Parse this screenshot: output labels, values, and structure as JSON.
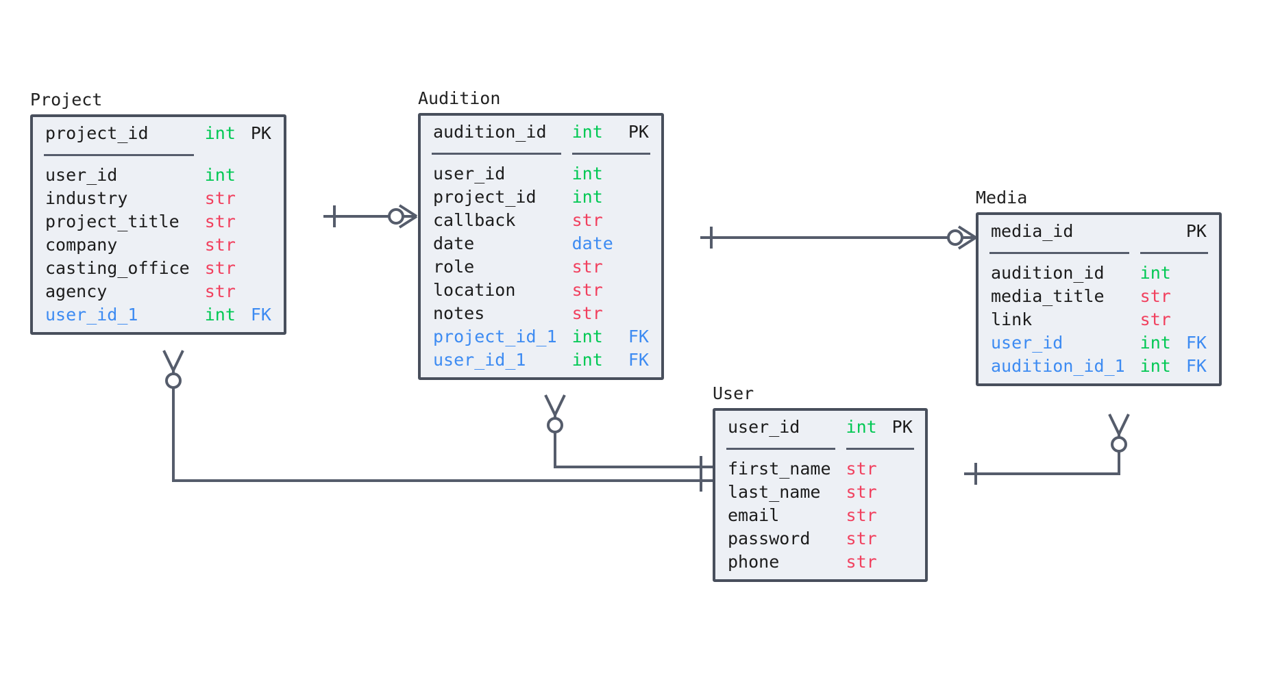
{
  "diagram": {
    "type": "entity-relationship-diagram",
    "background_color": "#ffffff",
    "colors": {
      "entity_fill": "#edf0f5",
      "entity_border": "#484f5c",
      "text": "#1c1c1c",
      "type_int": "#00c853",
      "type_str": "#f1405e",
      "type_date": "#3d8bf2",
      "foreign_key": "#3d8bf2",
      "connector": "#555c6b"
    }
  },
  "entities": [
    {
      "name": "Project",
      "primary_key": {
        "field": "project_id",
        "type": "int",
        "key": "PK"
      },
      "fields": [
        {
          "field": "user_id",
          "type": "int",
          "key": ""
        },
        {
          "field": "industry",
          "type": "str",
          "key": ""
        },
        {
          "field": "project_title",
          "type": "str",
          "key": ""
        },
        {
          "field": "company",
          "type": "str",
          "key": ""
        },
        {
          "field": "casting_office",
          "type": "str",
          "key": ""
        },
        {
          "field": "agency",
          "type": "str",
          "key": ""
        },
        {
          "field": "user_id_1",
          "type": "int",
          "key": "FK"
        }
      ]
    },
    {
      "name": "Audition",
      "primary_key": {
        "field": "audition_id",
        "type": "int",
        "key": "PK"
      },
      "fields": [
        {
          "field": "user_id",
          "type": "int",
          "key": ""
        },
        {
          "field": "project_id",
          "type": "int",
          "key": ""
        },
        {
          "field": "callback",
          "type": "str",
          "key": ""
        },
        {
          "field": "date",
          "type": "date",
          "key": ""
        },
        {
          "field": "role",
          "type": "str",
          "key": ""
        },
        {
          "field": "location",
          "type": "str",
          "key": ""
        },
        {
          "field": "notes",
          "type": "str",
          "key": ""
        },
        {
          "field": "project_id_1",
          "type": "int",
          "key": "FK"
        },
        {
          "field": "user_id_1",
          "type": "int",
          "key": "FK"
        }
      ]
    },
    {
      "name": "Media",
      "primary_key": {
        "field": "media_id",
        "type": "",
        "key": "PK"
      },
      "fields": [
        {
          "field": "audition_id",
          "type": "int",
          "key": ""
        },
        {
          "field": "media_title",
          "type": "str",
          "key": ""
        },
        {
          "field": "link",
          "type": "str",
          "key": ""
        },
        {
          "field": "user_id",
          "type": "int",
          "key": "FK"
        },
        {
          "field": "audition_id_1",
          "type": "int",
          "key": "FK"
        }
      ]
    },
    {
      "name": "User",
      "primary_key": {
        "field": "user_id",
        "type": "int",
        "key": "PK"
      },
      "fields": [
        {
          "field": "first_name",
          "type": "str",
          "key": ""
        },
        {
          "field": "last_name",
          "type": "str",
          "key": ""
        },
        {
          "field": "email",
          "type": "str",
          "key": ""
        },
        {
          "field": "password",
          "type": "str",
          "key": ""
        },
        {
          "field": "phone",
          "type": "str",
          "key": ""
        }
      ]
    }
  ],
  "relationships": [
    {
      "from": "Project",
      "to": "Audition",
      "from_cardinality": "one",
      "to_cardinality": "zero-or-many"
    },
    {
      "from": "Audition",
      "to": "Media",
      "from_cardinality": "one",
      "to_cardinality": "zero-or-many"
    },
    {
      "from": "Project",
      "to": "User",
      "from_cardinality": "zero-or-many",
      "to_cardinality": "one"
    },
    {
      "from": "Audition",
      "to": "User",
      "from_cardinality": "zero-or-many",
      "to_cardinality": "one"
    },
    {
      "from": "Media",
      "to": "User",
      "from_cardinality": "zero-or-many",
      "to_cardinality": "one"
    }
  ]
}
